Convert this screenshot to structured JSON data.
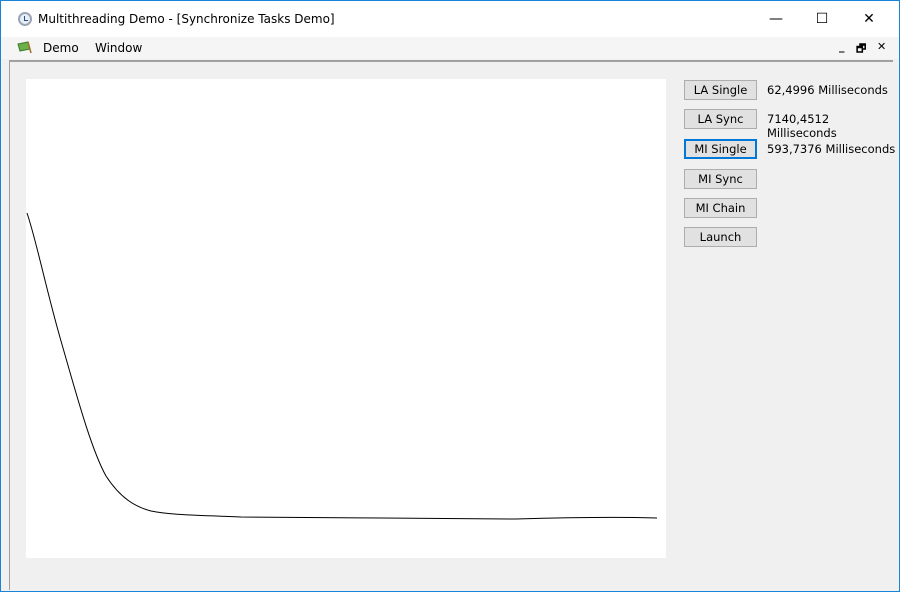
{
  "window": {
    "title": "Multithreading Demo - [Synchronize Tasks Demo]",
    "minimize": "—",
    "maximize": "☐",
    "close": "✕"
  },
  "menubar": {
    "items": [
      {
        "label": "Demo"
      },
      {
        "label": "Window"
      }
    ],
    "mdi_minimize": "_",
    "mdi_restore": "🗗",
    "mdi_close": "✕"
  },
  "buttons": [
    {
      "label": "LA Single",
      "result": "62,4996 Milliseconds"
    },
    {
      "label": "LA Sync",
      "result": "7140,4512 Milliseconds"
    },
    {
      "label": "MI Single",
      "result": "593,7376 Milliseconds",
      "focused": true
    },
    {
      "label": "MI Sync"
    },
    {
      "label": "MI Chain"
    },
    {
      "label": "Launch"
    }
  ],
  "colors": {
    "focus": "#0078d7",
    "curve": "#000000"
  }
}
